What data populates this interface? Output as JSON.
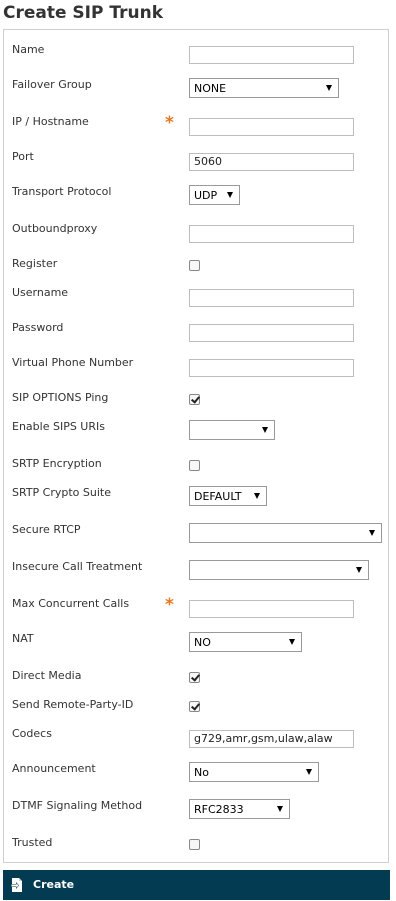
{
  "page": {
    "title": "Create SIP Trunk"
  },
  "form": {
    "name": {
      "label": "Name",
      "value": ""
    },
    "failover_group": {
      "label": "Failover Group",
      "value": "NONE"
    },
    "ip_hostname": {
      "label": "IP / Hostname",
      "required_mark": "*",
      "value": ""
    },
    "port": {
      "label": "Port",
      "value": "5060"
    },
    "transport_protocol": {
      "label": "Transport Protocol",
      "value": "UDP"
    },
    "outboundproxy": {
      "label": "Outboundproxy",
      "value": ""
    },
    "register": {
      "label": "Register",
      "checked": false
    },
    "username": {
      "label": "Username",
      "value": ""
    },
    "password": {
      "label": "Password",
      "value": ""
    },
    "virtual_phone_number": {
      "label": "Virtual Phone Number",
      "value": ""
    },
    "sip_options_ping": {
      "label": "SIP OPTIONS Ping",
      "checked": true
    },
    "enable_sips_uris": {
      "label": "Enable SIPS URIs",
      "value": ""
    },
    "srtp_encryption": {
      "label": "SRTP Encryption",
      "checked": false
    },
    "srtp_crypto_suite": {
      "label": "SRTP Crypto Suite",
      "value": "DEFAULT"
    },
    "secure_rtcp": {
      "label": "Secure RTCP",
      "value": ""
    },
    "insecure_call_treatment": {
      "label": "Insecure Call Treatment",
      "value": ""
    },
    "max_concurrent_calls": {
      "label": "Max Concurrent Calls",
      "required_mark": "*",
      "value": ""
    },
    "nat": {
      "label": "NAT",
      "value": "NO"
    },
    "direct_media": {
      "label": "Direct Media",
      "checked": true
    },
    "send_remote_party_id": {
      "label": "Send Remote-Party-ID",
      "checked": true
    },
    "codecs": {
      "label": "Codecs",
      "value": "g729,amr,gsm,ulaw,alaw"
    },
    "announcement": {
      "label": "Announcement",
      "value": "No"
    },
    "dtmf_signaling_method": {
      "label": "DTMF Signaling Method",
      "value": "RFC2833"
    },
    "trusted": {
      "label": "Trusted",
      "checked": false
    }
  },
  "footer": {
    "create_label": "Create",
    "create_icon": "document-arrow-icon"
  },
  "colors": {
    "footer_bg": "#023b52",
    "required": "#e87722"
  }
}
